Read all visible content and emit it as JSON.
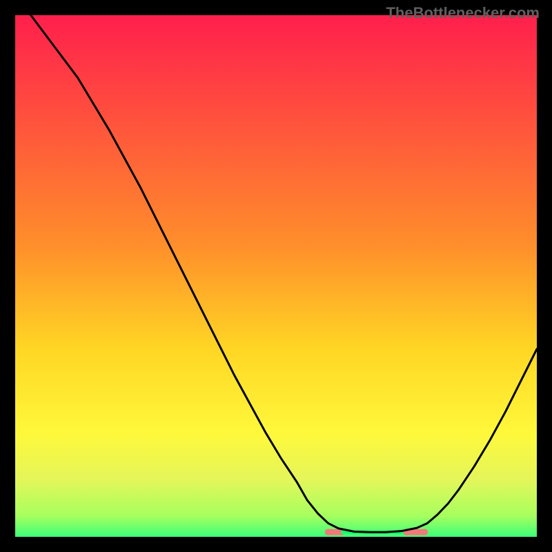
{
  "watermark": "TheBottlenecker.com",
  "colors": {
    "black": "#000000",
    "watermark": "#5f5f5f",
    "grad_top": "#ff1f4c",
    "grad_mid": "#ffd624",
    "grad_btm1": "#e4f65a",
    "grad_btm2": "#3cff7a",
    "seg_pink": "#f07a7a",
    "seg_bright": "#18ff6a",
    "line": "#000000"
  },
  "chart_data": {
    "type": "line",
    "title": "",
    "xlabel": "",
    "ylabel": "",
    "xlim": [
      0,
      100
    ],
    "ylim": [
      0,
      100
    ],
    "curve": [
      [
        3,
        100
      ],
      [
        6,
        96
      ],
      [
        9,
        92
      ],
      [
        12,
        88
      ],
      [
        15,
        83
      ],
      [
        18,
        78
      ],
      [
        21,
        72.5
      ],
      [
        24,
        67
      ],
      [
        27,
        61
      ],
      [
        30,
        55
      ],
      [
        33,
        49
      ],
      [
        36,
        43
      ],
      [
        39,
        37
      ],
      [
        42,
        31
      ],
      [
        45,
        25.5
      ],
      [
        48,
        20
      ],
      [
        51,
        15
      ],
      [
        54,
        10.5
      ],
      [
        56,
        7
      ],
      [
        58,
        4.5
      ],
      [
        60,
        2.6
      ],
      [
        62,
        1.6
      ],
      [
        65,
        1.0
      ],
      [
        68,
        0.9
      ],
      [
        71,
        0.9
      ],
      [
        74,
        1.1
      ],
      [
        77,
        1.7
      ],
      [
        79,
        2.6
      ],
      [
        81,
        4.3
      ],
      [
        83,
        6.4
      ],
      [
        85,
        9.0
      ],
      [
        88,
        13.5
      ],
      [
        91,
        18.5
      ],
      [
        94,
        24.0
      ],
      [
        97,
        30.0
      ],
      [
        100,
        36.0
      ]
    ],
    "bottom_segments": [
      {
        "x1": 60,
        "x2": 62.5,
        "color_key": "seg_pink"
      },
      {
        "x1": 62.5,
        "x2": 75.0,
        "color_key": "seg_bright"
      },
      {
        "x1": 75.0,
        "x2": 78.5,
        "color_key": "seg_pink"
      }
    ],
    "baseline_y": 0.9
  }
}
